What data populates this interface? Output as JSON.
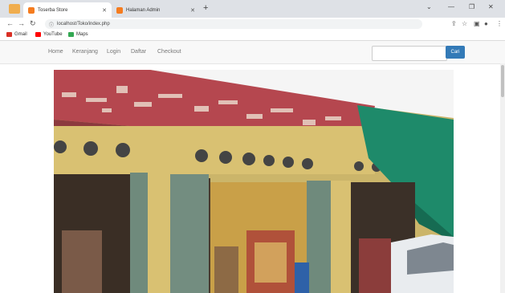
{
  "browser": {
    "tabs": [
      {
        "title": "Toserba Store",
        "active": true
      },
      {
        "title": "Halaman Admin",
        "active": false
      }
    ],
    "url": "localhost/Toko/index.php",
    "bookmarks": [
      {
        "label": "Gmail",
        "color": "#d93025"
      },
      {
        "label": "YouTube",
        "color": "#ff0000"
      },
      {
        "label": "Maps",
        "color": "#34a853"
      }
    ]
  },
  "site": {
    "nav": [
      "Home",
      "Keranjang",
      "Login",
      "Daftar",
      "Checkout"
    ],
    "search_placeholder": "",
    "search_button": "Cari"
  },
  "colors": {
    "brand": "#337ab7",
    "tab_favicon": "#f57c1f"
  },
  "icons": [
    "back-arrow-icon",
    "forward-arrow-icon",
    "reload-icon",
    "lock-icon",
    "share-icon",
    "star-icon",
    "sidebar-icon",
    "profile-icon",
    "menu-dots-icon",
    "close-icon",
    "plus-icon",
    "minimize-icon",
    "maximize-icon",
    "chevron-down-icon"
  ]
}
